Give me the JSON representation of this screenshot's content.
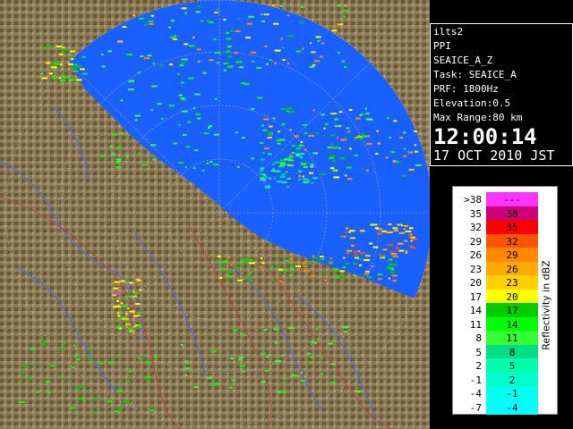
{
  "info": {
    "station": "ilts2",
    "scan_mode": "PPI",
    "product": "SEAICE_A_Z",
    "task": "Task: SEAICE_A",
    "prf": "PRF: 1800Hz",
    "elevation": "Elevation:0.5",
    "max_range": "Max Range:80 km",
    "time": "12:00:14",
    "date": "17 OCT 2010 JST"
  },
  "legend": {
    "title": "Reflectivity in dBZ",
    "rows": [
      {
        "lo": ">38",
        "hi": "---",
        "color": "#ff33ff"
      },
      {
        "lo": "35",
        "hi": "38",
        "color": "#cc0077"
      },
      {
        "lo": "32",
        "hi": "35",
        "color": "#ff0000"
      },
      {
        "lo": "29",
        "hi": "32",
        "color": "#ff5500"
      },
      {
        "lo": "26",
        "hi": "29",
        "color": "#ff8800"
      },
      {
        "lo": "23",
        "hi": "26",
        "color": "#ffaa00"
      },
      {
        "lo": "20",
        "hi": "23",
        "color": "#ffd000"
      },
      {
        "lo": "17",
        "hi": "20",
        "color": "#ffff00"
      },
      {
        "lo": "14",
        "hi": "17",
        "color": "#00cc00"
      },
      {
        "lo": "11",
        "hi": "14",
        "color": "#00ff00"
      },
      {
        "lo": "8",
        "hi": "11",
        "color": "#33ff33"
      },
      {
        "lo": "5",
        "hi": "8",
        "color": "#00dd88"
      },
      {
        "lo": "2",
        "hi": "5",
        "color": "#00ffaa"
      },
      {
        "lo": "-1",
        "hi": "2",
        "color": "#00ffcc"
      },
      {
        "lo": "-4",
        "hi": "-1",
        "color": "#00ffee"
      },
      {
        "lo": "-7",
        "hi": "-4",
        "color": "#00ffff"
      }
    ]
  },
  "colors": {
    "sea": "#1a5fff",
    "land": "#8a7a55",
    "background": "#000000"
  }
}
